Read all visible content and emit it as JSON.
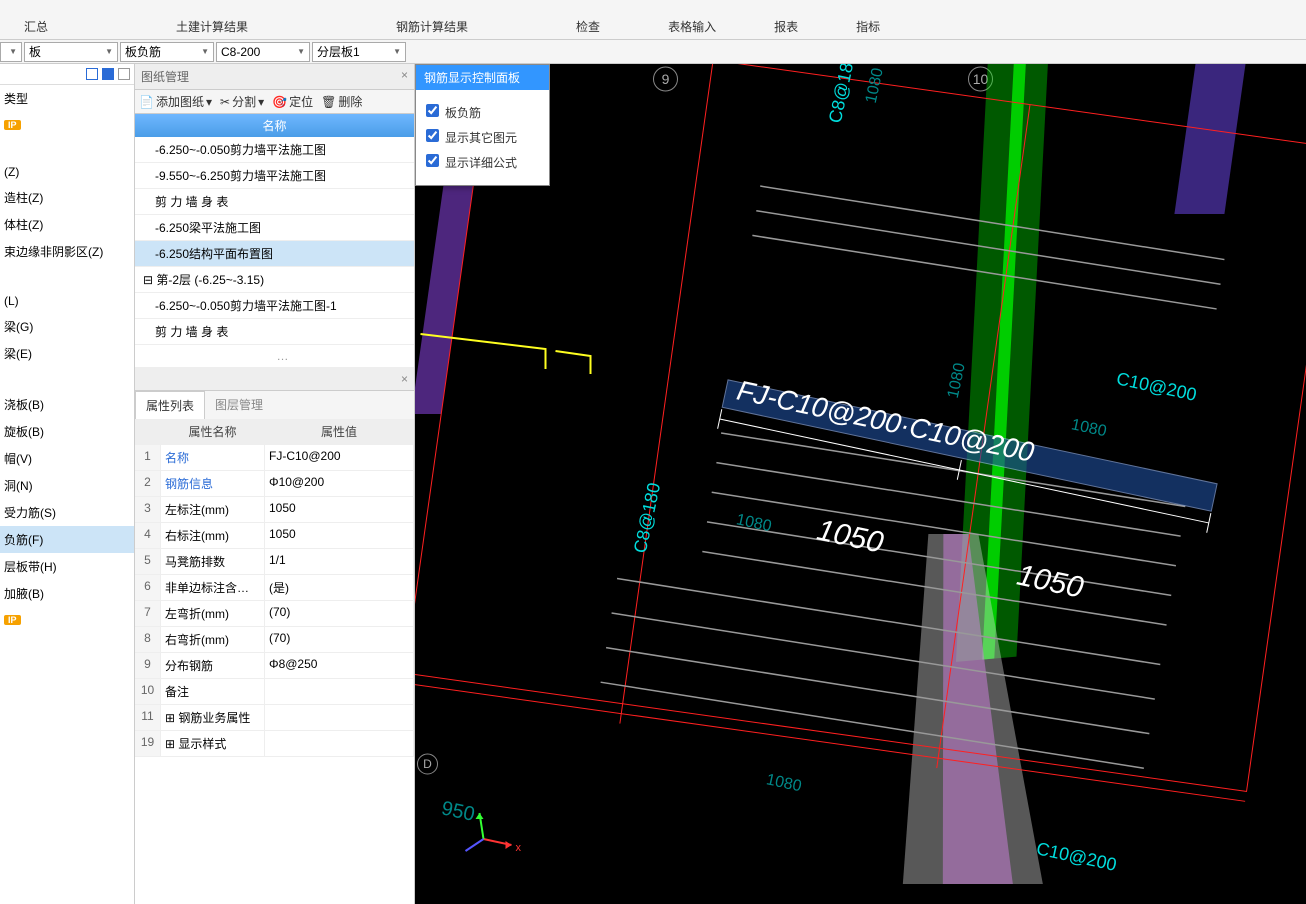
{
  "ribbon": {
    "groups": [
      "汇总",
      "土建计算结果",
      "钢筋计算结果",
      "检查",
      "表格输入",
      "报表",
      "指标"
    ]
  },
  "selectors": {
    "s1": "",
    "s2": "板",
    "s3": "板负筋",
    "s4": "C8-200",
    "s5": "分层板1"
  },
  "leftSidebar": {
    "items0": [
      "类型"
    ],
    "items": [
      "(Z)",
      "造柱(Z)",
      "体柱(Z)",
      "束边缘非阴影区(Z)",
      "",
      "(L)",
      "梁(G)",
      "梁(E)",
      "",
      "浇板(B)",
      "旋板(B)",
      "帽(V)",
      "洞(N)",
      "受力筋(S)",
      "负筋(F)",
      "层板带(H)",
      "加腋(B)"
    ],
    "selectedIndex": 14
  },
  "drawingPanel": {
    "title": "图纸管理",
    "toolbar": {
      "add": "添加图纸",
      "split": "分割",
      "locate": "定位",
      "del": "删除"
    },
    "header": "名称",
    "rows": [
      {
        "text": "-6.250~-0.050剪力墙平法施工图",
        "sel": false
      },
      {
        "text": "-9.550~-6.250剪力墙平法施工图",
        "sel": false
      },
      {
        "text": "剪 力 墙 身 表",
        "sel": false
      },
      {
        "text": "-6.250梁平法施工图",
        "sel": false
      },
      {
        "text": "-6.250结构平面布置图",
        "sel": true
      },
      {
        "text": "第-2层 (-6.25~-3.15)",
        "group": true
      },
      {
        "text": "-6.250~-0.050剪力墙平法施工图-1",
        "sel": false
      },
      {
        "text": "剪 力 墙 身 表",
        "sel": false
      }
    ]
  },
  "propPanel": {
    "tab1": "属性列表",
    "tab2": "图层管理",
    "headName": "属性名称",
    "headValue": "属性值",
    "rows": [
      {
        "i": "1",
        "n": "名称",
        "v": "FJ-C10@200",
        "link": true
      },
      {
        "i": "2",
        "n": "钢筋信息",
        "v": "Φ10@200",
        "link": true
      },
      {
        "i": "3",
        "n": "左标注(mm)",
        "v": "1050"
      },
      {
        "i": "4",
        "n": "右标注(mm)",
        "v": "1050"
      },
      {
        "i": "5",
        "n": "马凳筋排数",
        "v": "1/1"
      },
      {
        "i": "6",
        "n": "非单边标注含…",
        "v": "(是)"
      },
      {
        "i": "7",
        "n": "左弯折(mm)",
        "v": "(70)"
      },
      {
        "i": "8",
        "n": "右弯折(mm)",
        "v": "(70)"
      },
      {
        "i": "9",
        "n": "分布钢筋",
        "v": "Φ8@250"
      },
      {
        "i": "10",
        "n": "备注",
        "v": ""
      },
      {
        "i": "11",
        "n": "钢筋业务属性",
        "v": "",
        "exp": true
      },
      {
        "i": "19",
        "n": "显示样式",
        "v": "",
        "exp": true
      }
    ]
  },
  "floatPanel": {
    "title": "钢筋显示控制面板",
    "checks": [
      "板负筋",
      "显示其它图元",
      "显示详细公式"
    ]
  },
  "viewport": {
    "mainLabel": "FJ-C10@200·C10@200",
    "dim1": "1050",
    "dim2": "1050",
    "axis9": "9",
    "axis10": "10",
    "axisD": "D",
    "t1080a": "1080",
    "t1080b": "1080",
    "t1080c": "1080",
    "t1080d": "1080",
    "t950": "950",
    "spec1": "C8@180",
    "spec2": "C8@180",
    "spec3": "C10@200",
    "spec4": "C10@200"
  }
}
